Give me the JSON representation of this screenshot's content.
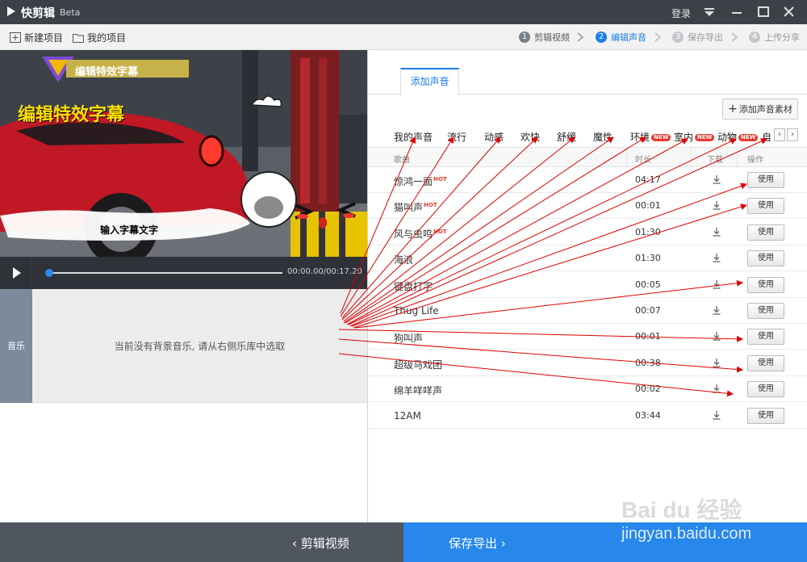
{
  "titlebar": {
    "app_name": "快剪辑",
    "beta": "Beta",
    "login": "登录"
  },
  "toolbar": {
    "new_project": "新建项目",
    "my_projects": "我的项目",
    "steps": [
      {
        "num": "1",
        "label": "剪辑视频"
      },
      {
        "num": "2",
        "label": "编辑声音"
      },
      {
        "num": "3",
        "label": "保存导出"
      },
      {
        "num": "4",
        "label": "上传分享"
      }
    ]
  },
  "preview": {
    "banner_title": "编辑特效字幕",
    "big_caption": "编辑特效字幕",
    "input_caption": "输入字幕文字",
    "time": "00:00.00/00:17.20",
    "progress": 0.0
  },
  "track": {
    "label": "音乐",
    "empty_text": "当前没有背景音乐, 请从右侧乐库中选取"
  },
  "sound_panel": {
    "tab": "添加声音",
    "add_material": "添加声音素材",
    "categories": [
      {
        "label": "我的声音",
        "badge": ""
      },
      {
        "label": "流行",
        "badge": ""
      },
      {
        "label": "动感",
        "badge": ""
      },
      {
        "label": "欢快",
        "badge": ""
      },
      {
        "label": "舒缓",
        "badge": ""
      },
      {
        "label": "魔性",
        "badge": ""
      },
      {
        "label": "环境",
        "badge": "NEW"
      },
      {
        "label": "室内",
        "badge": "NEW"
      },
      {
        "label": "动物",
        "badge": "NEW"
      },
      {
        "label": "自",
        "badge": ""
      }
    ],
    "columns": {
      "song": "歌曲",
      "duration": "时长",
      "download": "下载",
      "action": "操作"
    },
    "rows": [
      {
        "name": "惊鸿一面",
        "hot": "HOT",
        "duration": "04:17",
        "action": "使用"
      },
      {
        "name": "猫叫声",
        "hot": "HOT",
        "duration": "00:01",
        "action": "使用"
      },
      {
        "name": "风与虫鸣",
        "hot": "HOT",
        "duration": "01:30",
        "action": "使用"
      },
      {
        "name": "海浪",
        "hot": "",
        "duration": "01:30",
        "action": "使用"
      },
      {
        "name": "键盘打字",
        "hot": "",
        "duration": "00:05",
        "action": "使用"
      },
      {
        "name": "Thug Life",
        "hot": "",
        "duration": "00:07",
        "action": "使用"
      },
      {
        "name": "狗叫声",
        "hot": "",
        "duration": "00:01",
        "action": "使用"
      },
      {
        "name": "超级马戏团",
        "hot": "",
        "duration": "00:38",
        "action": "使用"
      },
      {
        "name": "绵羊咩咩声",
        "hot": "",
        "duration": "00:02",
        "action": "使用"
      },
      {
        "name": "12AM",
        "hot": "",
        "duration": "03:44",
        "action": "使用"
      }
    ]
  },
  "bottom": {
    "back_label": "剪辑视频",
    "next_label": "保存导出"
  },
  "watermark": {
    "logo": "Bai du 经验",
    "url": "jingyan.baidu.com"
  },
  "colors": {
    "accent": "#2787ea",
    "titlebar": "#3c4148",
    "annotation": "#e00000"
  }
}
